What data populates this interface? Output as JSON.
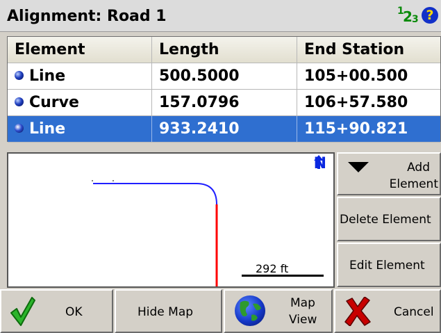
{
  "window": {
    "title": "Alignment: Road 1",
    "number_icon": "numeric-keypad-icon",
    "number_icon_digits": [
      "1",
      "2",
      "3"
    ],
    "help_icon": "help-icon",
    "help_glyph": "?"
  },
  "table": {
    "columns": [
      "Element",
      "Length",
      "End Station"
    ],
    "rows": [
      {
        "element": "Line",
        "length": "500.5000",
        "end_station": "105+00.500",
        "selected": false
      },
      {
        "element": "Curve",
        "length": "157.0796",
        "end_station": "106+57.580",
        "selected": false
      },
      {
        "element": "Line",
        "length": "933.2410",
        "end_station": "115+90.821",
        "selected": true
      }
    ]
  },
  "map": {
    "north_label": "N",
    "north_icon": "north-arrow-icon",
    "scale_label": "292 ft",
    "colors": {
      "line": "#2020ff",
      "selected_line": "#ff0000"
    }
  },
  "side_buttons": {
    "add_line1": "Add",
    "add_line2": "Element",
    "delete": "Delete Element",
    "edit": "Edit Element"
  },
  "bottom_buttons": {
    "ok": "OK",
    "hide_map": "Hide Map",
    "map_view_line1": "Map",
    "map_view_line2": "View",
    "cancel": "Cancel"
  },
  "colors": {
    "selection": "#2f6fd0",
    "check": "#2bb52b",
    "cancel_x": "#c80000",
    "north": "#0a28e0"
  }
}
